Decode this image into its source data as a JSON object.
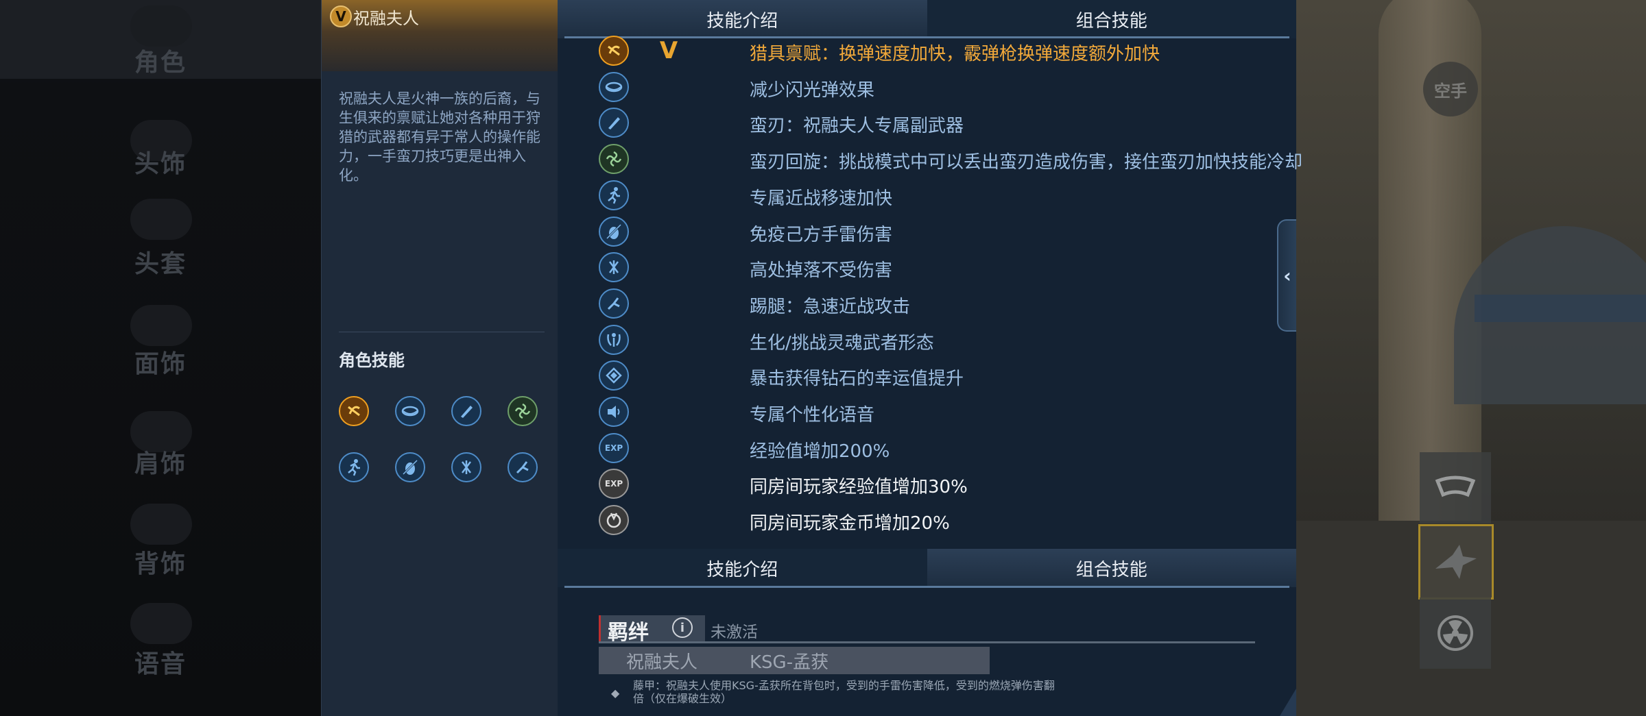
{
  "left_menu": {
    "items": [
      "角色",
      "头饰",
      "头套",
      "面饰",
      "肩饰",
      "背饰",
      "语音"
    ]
  },
  "right_scene": {
    "empty_hand_label": "空手"
  },
  "character": {
    "badge": "V",
    "name": "祝融夫人",
    "description": "祝融夫人是火神一族的后裔，与生俱来的禀赋让她对各种用于狩猎的武器都有异于常人的操作能力，一手蛮刀技巧更是出神入化。",
    "skills_title": "角色技能",
    "skill_icons": [
      {
        "icon": "reload-icon",
        "style": "gold"
      },
      {
        "icon": "flash-icon",
        "style": "blue"
      },
      {
        "icon": "machete-icon",
        "style": "blue"
      },
      {
        "icon": "spin-blade-icon",
        "style": "green"
      },
      {
        "icon": "run-icon",
        "style": "blue"
      },
      {
        "icon": "grenade-immune-icon",
        "style": "blue"
      },
      {
        "icon": "fall-immune-icon",
        "style": "blue"
      },
      {
        "icon": "kick-icon",
        "style": "blue"
      }
    ]
  },
  "tabs_top": [
    {
      "label": "技能介绍",
      "active": true
    },
    {
      "label": "组合技能",
      "active": false
    }
  ],
  "tabs_bottom": [
    {
      "label": "技能介绍",
      "active": false
    },
    {
      "label": "组合技能",
      "active": true
    }
  ],
  "skill_list": [
    {
      "icon": "reload-icon",
      "style": "gold",
      "label": "猎具禀赋：换弹速度加快，霰弹枪换弹速度额外加快",
      "variant": "hl",
      "badge": "V"
    },
    {
      "icon": "flash-icon",
      "style": "blue",
      "label": "减少闪光弹效果",
      "variant": "normal"
    },
    {
      "icon": "machete-icon",
      "style": "blue",
      "label": "蛮刃：祝融夫人专属副武器",
      "variant": "normal"
    },
    {
      "icon": "spin-blade-icon",
      "style": "green",
      "label": "蛮刃回旋：挑战模式中可以丢出蛮刃造成伤害，接住蛮刃加快技能冷却",
      "variant": "normal"
    },
    {
      "icon": "run-icon",
      "style": "blue",
      "label": "专属近战移速加快",
      "variant": "normal"
    },
    {
      "icon": "grenade-immune-icon",
      "style": "blue",
      "label": "免疫己方手雷伤害",
      "variant": "normal"
    },
    {
      "icon": "fall-immune-icon",
      "style": "blue",
      "label": "高处掉落不受伤害",
      "variant": "normal"
    },
    {
      "icon": "kick-icon",
      "style": "blue",
      "label": "踢腿：急速近战攻击",
      "variant": "normal"
    },
    {
      "icon": "spirit-icon",
      "style": "blue",
      "label": "生化/挑战灵魂武者形态",
      "variant": "normal"
    },
    {
      "icon": "diamond-icon",
      "style": "blue",
      "label": "暴击获得钻石的幸运值提升",
      "variant": "normal"
    },
    {
      "icon": "voice-icon",
      "style": "blue",
      "label": "专属个性化语音",
      "variant": "normal"
    },
    {
      "icon": "exp-icon",
      "style": "blue",
      "label": "经验值增加200%",
      "variant": "normal",
      "icon_text": "EXP"
    },
    {
      "icon": "room-exp-icon",
      "style": "grey",
      "label": "同房间玩家经验值增加30%",
      "variant": "white",
      "icon_text": "EXP"
    },
    {
      "icon": "room-coin-icon",
      "style": "grey",
      "label": "同房间玩家金币增加20%",
      "variant": "white"
    }
  ],
  "bond": {
    "title": "羁绊",
    "info_icon": "i",
    "status": "未激活",
    "members": [
      "祝融夫人",
      "KSG-孟获"
    ],
    "bullet": "◆",
    "description": "藤甲：祝融夫人使用KSG-孟获所在背包时，受到的手雷伤害降低，受到的燃烧弹伤害翻倍（仅在爆破生效）"
  },
  "collapse_icon": "‹"
}
